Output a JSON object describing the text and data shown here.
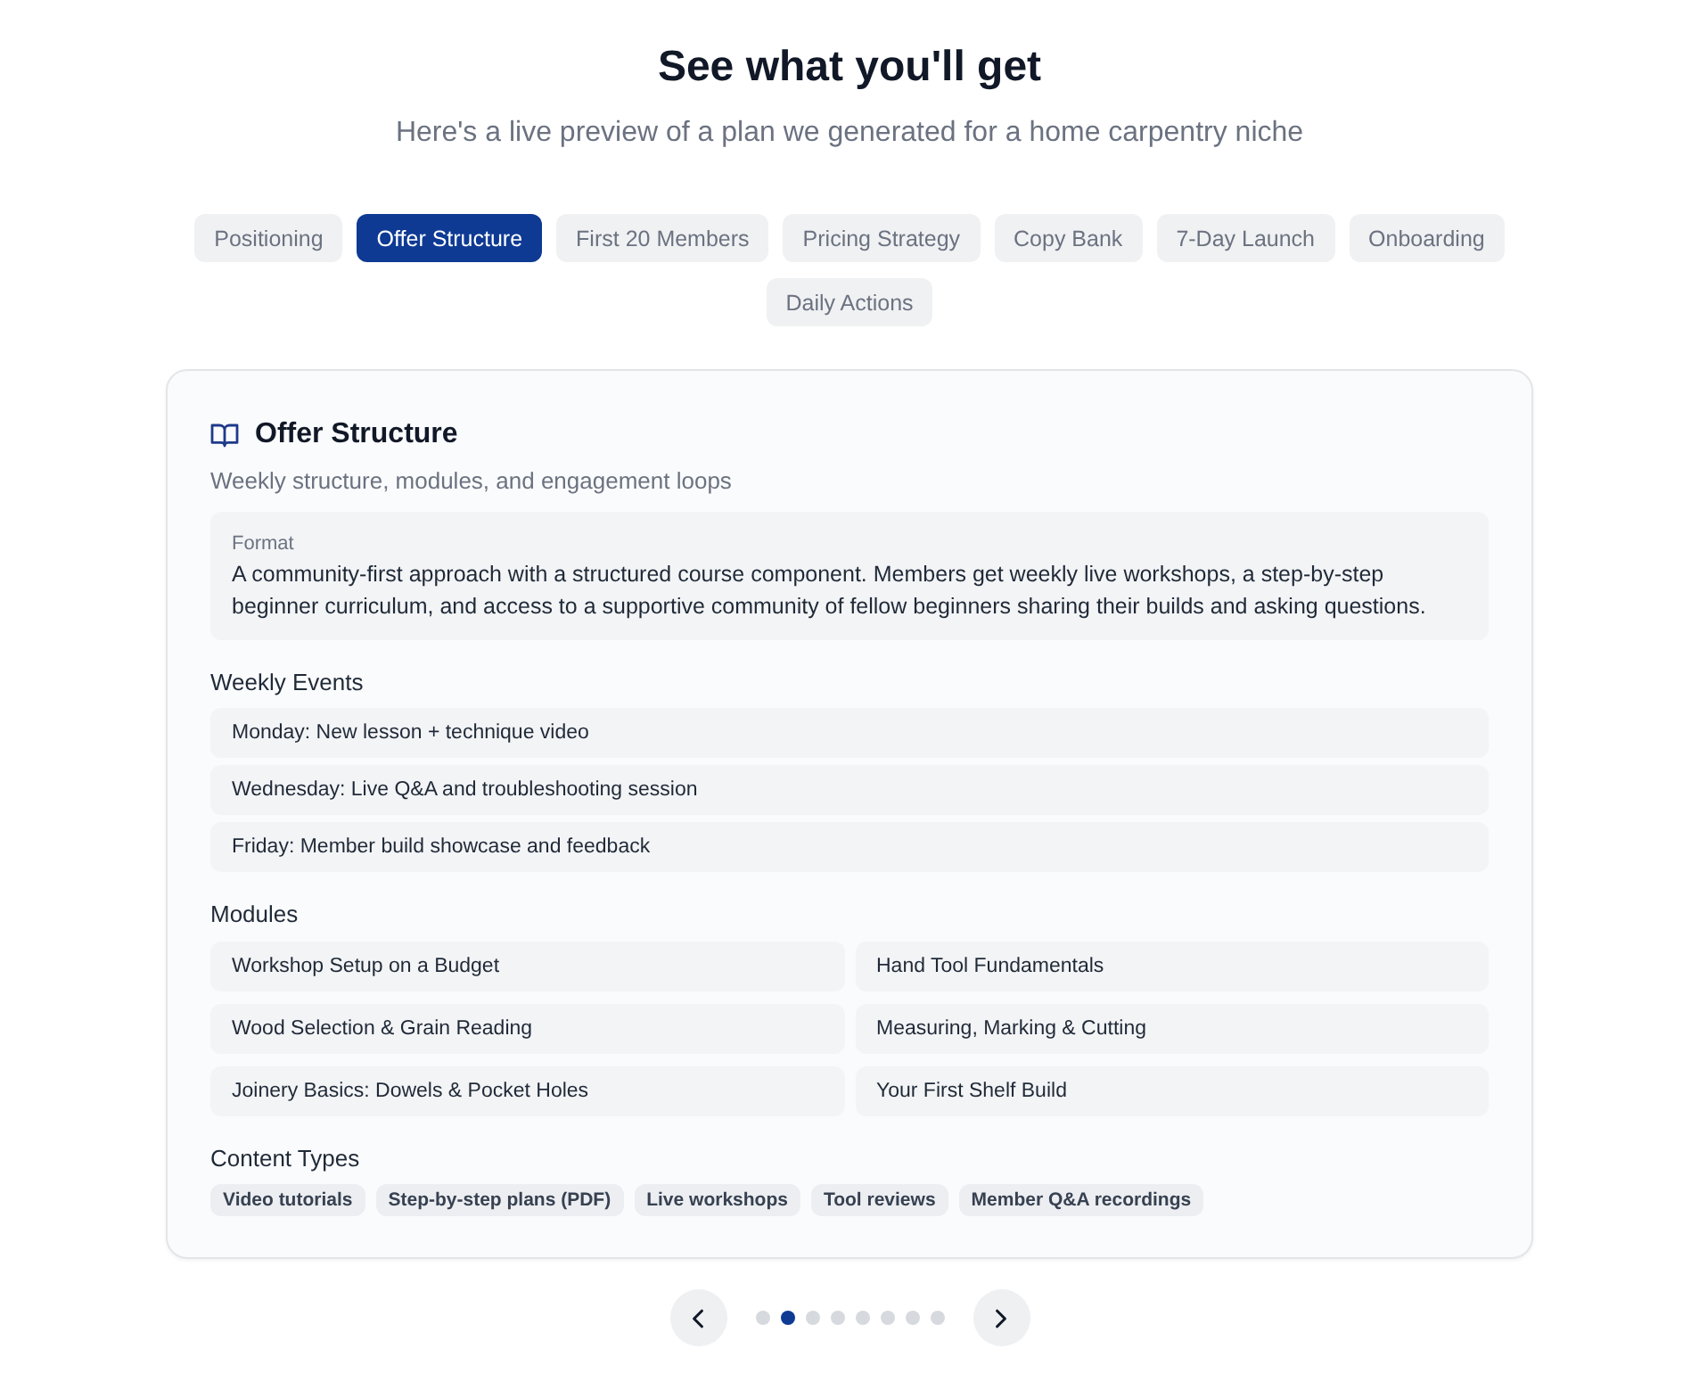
{
  "header": {
    "title": "See what you'll get",
    "subtitle": "Here's a live preview of a plan we generated for a home carpentry niche"
  },
  "tabs": [
    {
      "label": "Positioning",
      "selected": false
    },
    {
      "label": "Offer Structure",
      "selected": true
    },
    {
      "label": "First 20 Members",
      "selected": false
    },
    {
      "label": "Pricing Strategy",
      "selected": false
    },
    {
      "label": "Copy Bank",
      "selected": false
    },
    {
      "label": "7-Day Launch",
      "selected": false
    },
    {
      "label": "Onboarding",
      "selected": false
    },
    {
      "label": "Daily Actions",
      "selected": false
    }
  ],
  "card": {
    "title": "Offer Structure",
    "subtitle": "Weekly structure, modules, and engagement loops",
    "format": {
      "label": "Format",
      "text": "A community-first approach with a structured course component. Members get weekly live workshops, a step-by-step beginner curriculum, and access to a supportive community of fellow beginners sharing their builds and asking questions."
    },
    "sections": [
      {
        "kind": "list",
        "heading": "Weekly Events",
        "items": [
          "Monday: New lesson + technique video",
          "Wednesday: Live Q&A and troubleshooting session",
          "Friday: Member build showcase and feedback"
        ]
      },
      {
        "kind": "grid",
        "heading": "Modules",
        "items": [
          "Workshop Setup on a Budget",
          "Hand Tool Fundamentals",
          "Wood Selection & Grain Reading",
          "Measuring, Marking & Cutting",
          "Joinery Basics: Dowels & Pocket Holes",
          "Your First Shelf Build"
        ]
      },
      {
        "kind": "chips",
        "heading": "Content Types",
        "items": [
          "Video tutorials",
          "Step-by-step plans (PDF)",
          "Live workshops",
          "Tool reviews",
          "Member Q&A recordings"
        ]
      }
    ]
  },
  "pager": {
    "dots": [
      {
        "selected": false
      },
      {
        "selected": true
      },
      {
        "selected": false
      },
      {
        "selected": false
      },
      {
        "selected": false
      },
      {
        "selected": false
      },
      {
        "selected": false
      },
      {
        "selected": false
      }
    ]
  }
}
